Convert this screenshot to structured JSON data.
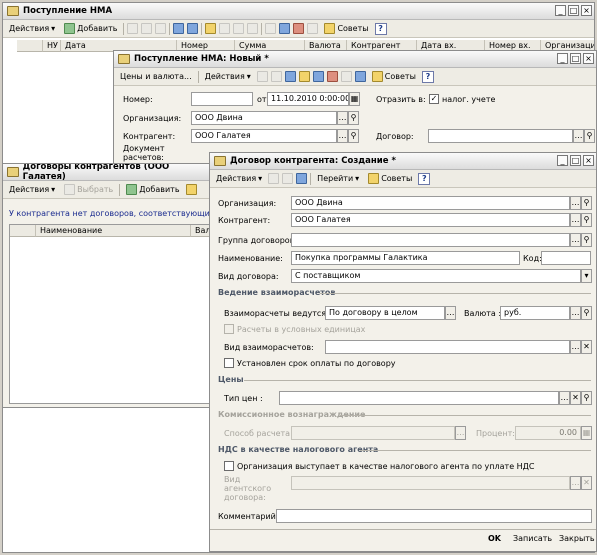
{
  "w1": {
    "title": "Поступление НМА",
    "actions": "Действия",
    "add": "Добавить",
    "cols": [
      "НУ",
      "Дата",
      "Номер",
      "Сумма",
      "Валюта",
      "Контрагент",
      "Дата вх.",
      "Номер вх.",
      "Организация"
    ],
    "tips": "Советы"
  },
  "w2": {
    "title": "Поступление НМА: Новый *",
    "prices": "Цены и валюта...",
    "actions": "Действия",
    "tips": "Советы",
    "number_label": "Номер:",
    "number_value": "",
    "from_label": "от:",
    "date_value": "11.10.2010 0:00:00",
    "reflect_label": "Отразить в:",
    "tax_label": "налог. учете",
    "org_label": "Организация:",
    "org_value": "ООО Двина",
    "contr_label": "Контрагент:",
    "contr_value": "ООО Галатея",
    "contract_label": "Договор:",
    "contract_value": "",
    "doc_label": "Документ расчетов:"
  },
  "w3": {
    "title": "Договоры контрагентов (ООО Галатея)",
    "actions": "Действия",
    "select": "Выбрать",
    "add": "Добавить",
    "message": "У контрагента нет договоров, соответствующих условиям выбора",
    "col_name": "Наименование",
    "col_cur": "Валюта"
  },
  "w4": {
    "title": "Договор контрагента: Создание *",
    "actions": "Действия",
    "goto": "Перейти",
    "tips": "Советы",
    "org_label": "Организация:",
    "org_value": "ООО Двина",
    "contr_label": "Контрагент:",
    "contr_value": "ООО Галатея",
    "group_label": "Группа договоров:",
    "group_value": "",
    "name_label": "Наименование:",
    "name_value": "Покупка программы Галактика",
    "code_label": "Код:",
    "code_value": "",
    "type_label": "Вид договора:",
    "type_value": "С поставщиком",
    "sec_settle": "Ведение взаиморасчетов",
    "settle_label": "Взаиморасчеты ведутся:",
    "settle_value": "По договору в целом",
    "cur_label": "Валюта :",
    "cur_value": "руб.",
    "cond_units": "Расчеты в условных единицах",
    "settle_kind_label": "Вид взаиморасчетов:",
    "settle_kind_value": "",
    "due_label": "Установлен срок оплаты по договору",
    "sec_prices": "Цены",
    "price_type_label": "Тип цен :",
    "price_type_value": "",
    "sec_comm": "Комиссионное вознаграждение",
    "calc_label": "Способ расчета:",
    "calc_value": "",
    "pct_label": "Процент:",
    "pct_value": "0.00",
    "sec_vat": "НДС в качестве налогового агента",
    "vat_agent": "Организация выступает в качестве налогового агента по уплате НДС",
    "agent_label": "Вид агентского договора:",
    "agent_value": "",
    "comment_label": "Комментарий:",
    "comment_value": "",
    "ok": "OK",
    "save": "Записать",
    "close": "Закрыть"
  }
}
